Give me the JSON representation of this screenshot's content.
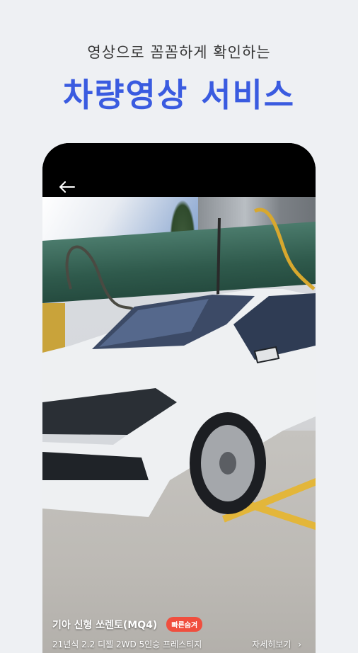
{
  "promo": {
    "subtitle": "영상으로 꼼꼼하게 확인하는",
    "headline": "차량영상 서비스",
    "headline_color": "#3a5be0"
  },
  "video_screen": {
    "back_icon": "back-arrow-icon",
    "car": {
      "name": "기아 신형 쏘렌토(MQ4)",
      "badge": "빠른숨겨",
      "badge_color": "#f04e3e",
      "spec": "21년식 2.2 디젤 2WD 5인승 프레스티지",
      "detail_link": "자세히보기"
    }
  }
}
